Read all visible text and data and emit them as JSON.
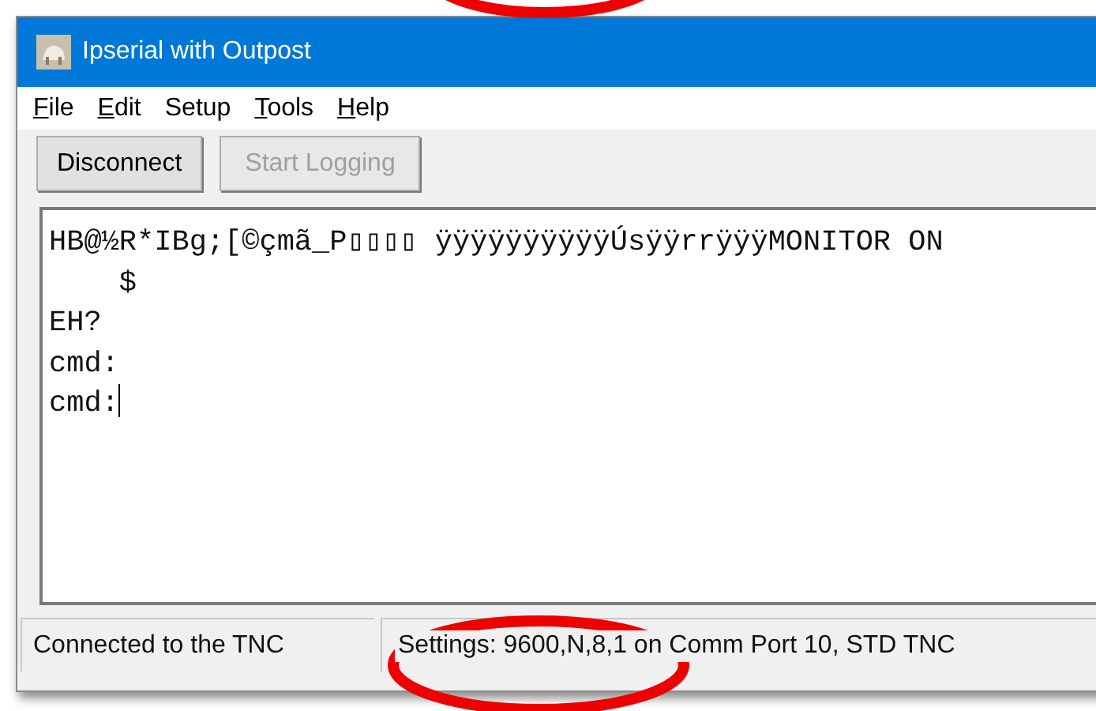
{
  "window": {
    "title": "Ipserial with Outpost"
  },
  "menu": [
    {
      "label": "File",
      "underlined_first_letter": true
    },
    {
      "label": "Edit",
      "underlined_first_letter": true
    },
    {
      "label": "Setup",
      "underlined_first_letter": false
    },
    {
      "label": "Tools",
      "underlined_first_letter": true
    },
    {
      "label": "Help",
      "underlined_first_letter": true
    }
  ],
  "buttons": [
    {
      "label": "Disconnect",
      "disabled": false
    },
    {
      "label": "Start Logging",
      "disabled": true
    }
  ],
  "terminal": {
    "lines": [
      "HB@½R*IBg;[©çmã_P▯▯▯▯ ÿÿÿÿÿÿÿÿÿÿÚsÿÿrrÿÿÿMONITOR ON",
      "    $",
      "EH?",
      "cmd:",
      "cmd:"
    ]
  },
  "status_bar": [
    "Connected to the TNC",
    "Settings: 9600,N,8,1 on Comm Port 10, STD TNC"
  ]
}
